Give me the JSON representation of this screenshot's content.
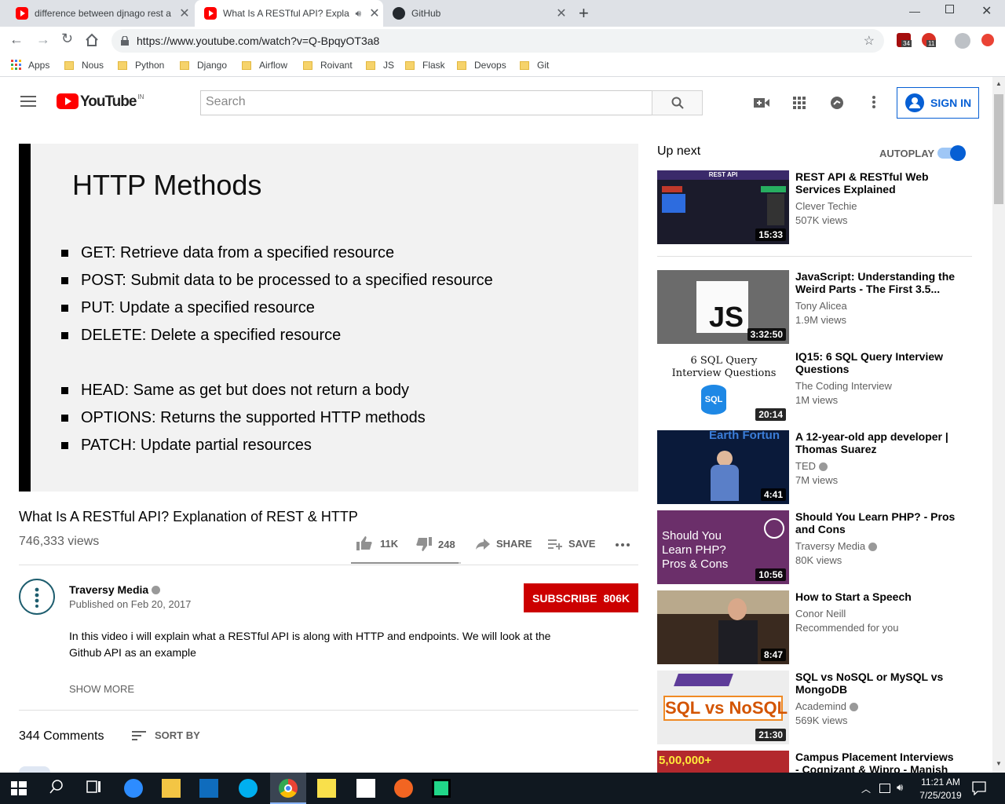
{
  "tabs": [
    {
      "title": "difference between djnago rest a",
      "favicon": "youtube-icon"
    },
    {
      "title": "What Is A RESTful API? Expla",
      "favicon": "youtube-icon"
    },
    {
      "title": "GitHub",
      "favicon": "github-icon"
    }
  ],
  "url": "https://www.youtube.com/watch?v=Q-BpqyOT3a8",
  "extension_badges": [
    "34",
    "11"
  ],
  "bookmarks": [
    "Apps",
    "Nous",
    "Python",
    "Django",
    "Airflow",
    "Roivant",
    "JS",
    "Flask",
    "Devops",
    "Git"
  ],
  "yt": {
    "logo_text": "YouTube",
    "region": "IN",
    "search_placeholder": "Search",
    "signin_label": "SIGN IN"
  },
  "slide": {
    "title": "HTTP Methods",
    "items": [
      {
        "method": "GET:",
        "desc": " Retrieve data from a specified resource"
      },
      {
        "method": "POST:",
        "desc": " Submit data to be processed to a specified resource"
      },
      {
        "method": "PUT:",
        "desc": " Update a specified resource"
      },
      {
        "method": "DELETE:",
        "desc": " Delete a specified resource"
      },
      {
        "method": "HEAD:",
        "desc": " Same as get but does not return a body"
      },
      {
        "method": "OPTIONS:",
        "desc": " Returns the supported HTTP methods"
      },
      {
        "method": "PATCH:",
        "desc": " Update partial resources"
      }
    ]
  },
  "video": {
    "title": "What Is A RESTful API? Explanation of REST & HTTP",
    "views": "746,333 views",
    "likes": "11K",
    "dislikes": "248",
    "share_label": "SHARE",
    "save_label": "SAVE",
    "like_ratio": 0.978
  },
  "channel": {
    "name": "Traversy Media",
    "published": "Published on Feb 20, 2017",
    "subscribe_label": "SUBSCRIBE",
    "subscribers": "806K",
    "description": "In this video i will explain what a RESTful API is along with HTTP and endpoints. We will look at the Github API as an example",
    "show_more": "SHOW MORE"
  },
  "comments": {
    "count": "344 Comments",
    "sort_label": "SORT BY"
  },
  "sidebar": {
    "up_next": "Up next",
    "autoplay": "AUTOPLAY",
    "items": [
      {
        "title": "REST API & RESTful Web Services Explained",
        "channel": "Clever Techie",
        "views": "507K views",
        "duration": "15:33",
        "thumb_text": "REST API"
      },
      {
        "title": "JavaScript: Understanding the Weird Parts - The First 3.5...",
        "channel": "Tony Alicea",
        "views": "1.9M views",
        "duration": "3:32:50",
        "thumb_text": "JS"
      },
      {
        "title": "IQ15: 6 SQL Query Interview Questions",
        "channel": "The Coding Interview",
        "views": "1M views",
        "duration": "20:14",
        "thumb_text": "6 SQL Query Interview Questions",
        "thumb_badge": "SQL"
      },
      {
        "title": "A 12-year-old app developer | Thomas Suarez",
        "channel": "TED",
        "views": "7M views",
        "duration": "4:41",
        "verified": true,
        "thumb_text": "Earth Fortun"
      },
      {
        "title": "Should You Learn PHP? - Pros and Cons",
        "channel": "Traversy Media",
        "views": "80K views",
        "duration": "10:56",
        "verified": true,
        "thumb_text": "Should You Learn PHP? Pros & Cons"
      },
      {
        "title": "How to Start a Speech",
        "channel": "Conor Neill",
        "views": "Recommended for you",
        "duration": "8:47"
      },
      {
        "title": "SQL vs NoSQL or MySQL vs MongoDB",
        "channel": "Academind",
        "views": "569K views",
        "duration": "21:30",
        "verified": true,
        "thumb_text": "SQL vs NoSQL"
      },
      {
        "title": "Campus Placement Interviews - Cognizant & Wipro - Manish R...",
        "channel": "",
        "views": "",
        "duration": "",
        "thumb_text": "5,00,000+"
      }
    ]
  },
  "taskbar": {
    "time": "11:21 AM",
    "date": "7/25/2019"
  },
  "colors": {
    "yt_red": "#ff0000",
    "subscribe_red": "#cc0000",
    "link_blue": "#065fd4",
    "toggle_blue": "#3ea6ff",
    "taskbar": "#101820"
  }
}
